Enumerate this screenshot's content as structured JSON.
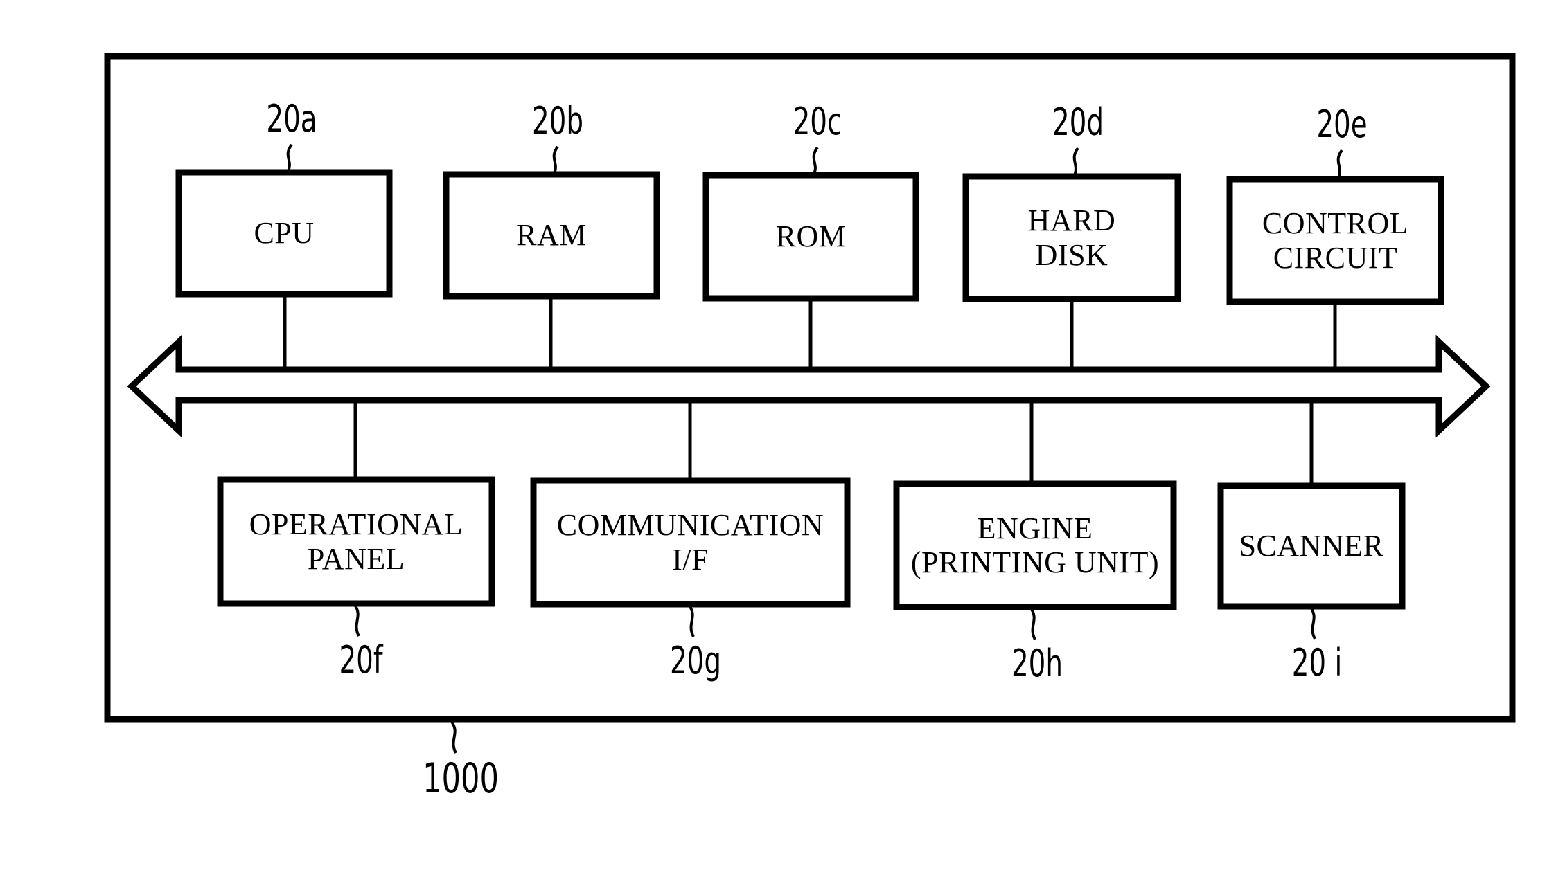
{
  "figure": {
    "device_ref": "1000",
    "outer_frame": {
      "name": "device-outline"
    }
  },
  "bus": {
    "name": "system-bus",
    "style": "double-headed-hollow-arrow"
  },
  "top_row": [
    {
      "label": "CPU",
      "lines": [
        "CPU"
      ],
      "ref": "20a"
    },
    {
      "label": "RAM",
      "lines": [
        "RAM"
      ],
      "ref": "20b"
    },
    {
      "label": "ROM",
      "lines": [
        "ROM"
      ],
      "ref": "20c"
    },
    {
      "label": "HARD DISK",
      "lines": [
        "HARD",
        "DISK"
      ],
      "ref": "20d"
    },
    {
      "label": "CONTROL CIRCUIT",
      "lines": [
        "CONTROL",
        "CIRCUIT"
      ],
      "ref": "20e"
    }
  ],
  "bottom_row": [
    {
      "label": "OPERATIONAL PANEL",
      "lines": [
        "OPERATIONAL",
        "PANEL"
      ],
      "ref": "20f"
    },
    {
      "label": "COMMUNICATION I/F",
      "lines": [
        "COMMUNICATION",
        "I/F"
      ],
      "ref": "20g"
    },
    {
      "label": "ENGINE (PRINTING UNIT)",
      "lines": [
        "ENGINE",
        "(PRINTING UNIT)"
      ],
      "ref": "20h"
    },
    {
      "label": "SCANNER",
      "lines": [
        "SCANNER"
      ],
      "ref": "20 i"
    }
  ],
  "colors": {
    "ink": "#000000",
    "paper": "#ffffff"
  }
}
